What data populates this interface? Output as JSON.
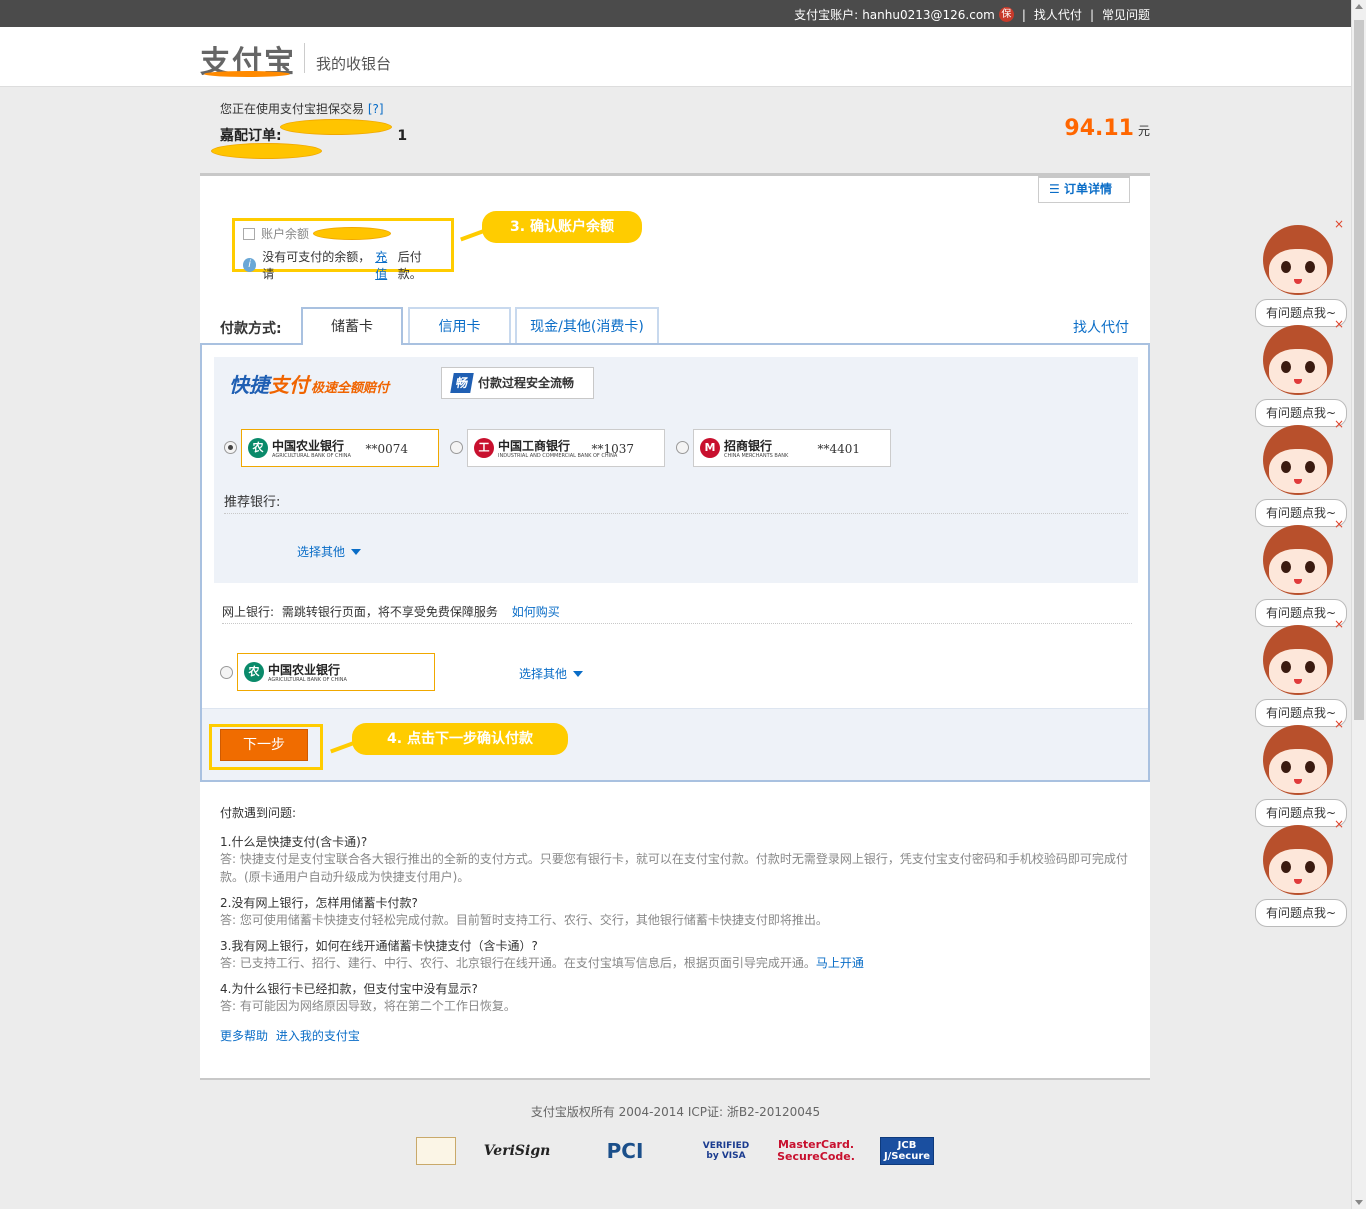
{
  "topbar": {
    "account_label": "支付宝账户:",
    "account_email": "hanhu0213@126.com",
    "bao_icon": "保",
    "find_pay": "找人代付",
    "faq": "常见问题"
  },
  "header": {
    "logo_text": "支付宝",
    "subtitle": "我的收银台"
  },
  "order": {
    "guarantee_text": "您正在使用支付宝担保交易",
    "help_link": "[?]",
    "order_label": "嘉配订单:",
    "order_tail": "1",
    "amount": "94.11",
    "unit": "元"
  },
  "panel": {
    "order_detail": "订单详情",
    "balance_label": "账户余额",
    "no_balance_prefix": "没有可支付的余额，请",
    "recharge_link": "充值",
    "no_balance_suffix": "后付款。",
    "callout_balance": "3. 确认账户余额",
    "pay_method_label": "付款方式:",
    "tabs": [
      "储蓄卡",
      "信用卡",
      "现金/其他(消费卡)"
    ],
    "find_pay_link": "找人代付",
    "quick": {
      "logo_main": "快捷",
      "logo_tag": "支付",
      "slogan": "极速全额赔付",
      "secure_icon": "畅",
      "secure_text": "付款过程安全流畅"
    },
    "bankcards": [
      {
        "name": "中国农业银行",
        "en": "AGRICULTURAL BANK OF CHINA",
        "tail": "**0074",
        "icon": "农",
        "color": "#0a8a6a"
      },
      {
        "name": "中国工商银行",
        "en": "INDUSTRIAL AND COMMERCIAL BANK OF CHINA",
        "tail": "**1037",
        "icon": "工",
        "color": "#c8102e"
      },
      {
        "name": "招商银行",
        "en": "CHINA MERCHANTS BANK",
        "tail": "**4401",
        "icon": "M",
        "color": "#c8102e"
      }
    ],
    "recommend_label": "推荐银行:",
    "choose_other": "选择其他",
    "netbank_label": "网上银行:",
    "netbank_note": "需跳转银行页面，将不享受免费保障服务",
    "how_to_buy": "如何购买",
    "netbank_card": {
      "name": "中国农业银行",
      "en": "AGRICULTURAL BANK OF CHINA",
      "icon": "农"
    },
    "next_button": "下一步",
    "callout_next": "4. 点击下一步确认付款"
  },
  "faq": {
    "title": "付款遇到问题:",
    "items": [
      {
        "q": "1.什么是快捷支付(含卡通)?",
        "a": "答: 快捷支付是支付宝联合各大银行推出的全新的支付方式。只要您有银行卡，就可以在支付宝付款。付款时无需登录网上银行，凭支付宝支付密码和手机校验码即可完成付款。(原卡通用户自动升级成为快捷支付用户)。",
        "link": ""
      },
      {
        "q": "2.没有网上银行，怎样用储蓄卡付款?",
        "a": "答: 您可使用储蓄卡快捷支付轻松完成付款。目前暂时支持工行、农行、交行，其他银行储蓄卡快捷支付即将推出。",
        "link": ""
      },
      {
        "q": "3.我有网上银行，如何在线开通储蓄卡快捷支付（含卡通）?",
        "a": "答: 已支持工行、招行、建行、中行、农行、北京银行在线开通。在支付宝填写信息后，根据页面引导完成开通。",
        "link": "马上开通"
      },
      {
        "q": "4.为什么银行卡已经扣款，但支付宝中没有显示?",
        "a": "答: 有可能因为网络原因导致，将在第二个工作日恢复。",
        "link": ""
      }
    ],
    "more_help": "更多帮助",
    "enter_alipay": "进入我的支付宝"
  },
  "footer": {
    "copyright": "支付宝版权所有 2004-2014 ICP证: 浙B2-20120045",
    "certs": [
      "VeriSign",
      "PCI",
      "VERIFIED by VISA",
      "MasterCard. SecureCode.",
      "JCB J/Secure"
    ]
  },
  "chat": {
    "bubble": "有问题点我~",
    "close": "×",
    "count": 7
  },
  "colors": {
    "accent_orange": "#ff6600",
    "button_orange": "#f06c00",
    "callout_yellow": "#ffcc00",
    "link_blue": "#0a6dc7",
    "tab_border": "#a9c1e0"
  }
}
